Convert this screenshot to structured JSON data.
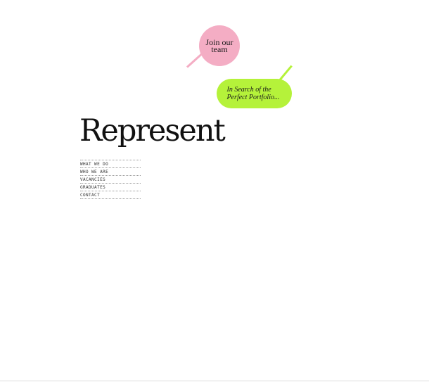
{
  "bubbles": {
    "join_team": {
      "label": "Join our team",
      "color": "#f4adc4"
    },
    "portfolio": {
      "label": "In Search of the Perfect Portfolio...",
      "color": "#b5f23a"
    }
  },
  "logo": {
    "text": "Represent"
  },
  "nav": {
    "items": [
      {
        "label": "WHAT WE DO"
      },
      {
        "label": "WHO WE ARE"
      },
      {
        "label": "VACANCIES"
      },
      {
        "label": "GRADUATES"
      },
      {
        "label": "CONTACT"
      }
    ]
  }
}
